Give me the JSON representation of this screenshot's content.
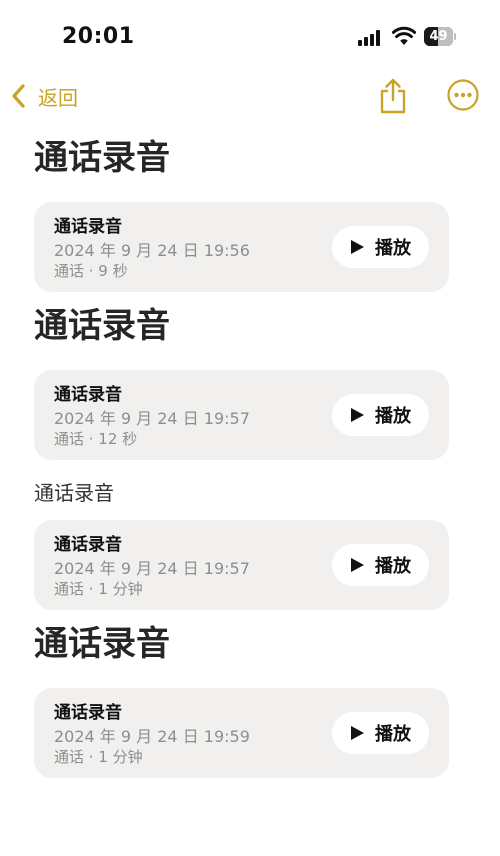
{
  "status_bar": {
    "time": "20:01",
    "battery_percent": "49",
    "battery_level": 0.49
  },
  "nav": {
    "back_label": "返回",
    "back_icon": "chevron-left-icon",
    "share_icon": "share-icon",
    "more_icon": "more-ellipsis-icon",
    "accent_color": "#c9a227"
  },
  "sections": [
    {
      "title": "通话录音",
      "card": {
        "title": "通话录音",
        "date": "2024 年 9 月 24 日 19:56",
        "meta": "通话 · 9 秒",
        "play_label": "播放"
      }
    },
    {
      "title": "通话录音",
      "card": {
        "title": "通话录音",
        "date": "2024 年 9 月 24 日 19:57",
        "meta": "通话 · 12 秒",
        "play_label": "播放"
      }
    },
    {
      "title": "通话录音",
      "card": {
        "title": "通话录音",
        "date": "2024 年 9 月 24 日 19:57",
        "meta": "通话 · 1 分钟",
        "play_label": "播放"
      }
    },
    {
      "title": "通话录音",
      "card": {
        "title": "通话录音",
        "date": "2024 年 9 月 24 日 19:59",
        "meta": "通话 · 1 分钟",
        "play_label": "播放"
      }
    }
  ]
}
